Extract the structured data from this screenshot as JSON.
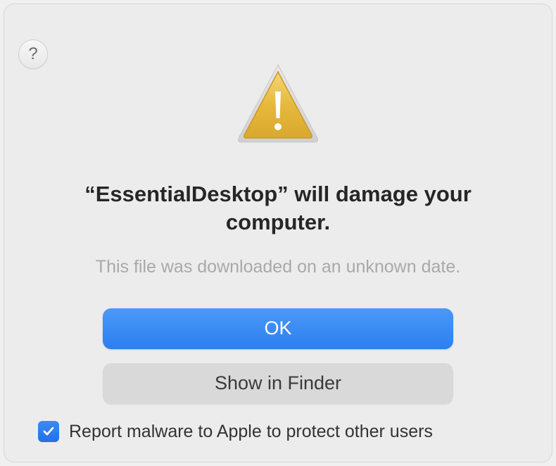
{
  "dialog": {
    "title": "“EssentialDesktop” will damage your computer.",
    "subtitle": "This file was downloaded on an unknown date.",
    "help_label": "?"
  },
  "buttons": {
    "ok": "OK",
    "show_in_finder": "Show in Finder"
  },
  "checkbox": {
    "label": "Report malware to Apple to protect other users",
    "checked": true
  },
  "colors": {
    "primary": "#2b7ff0",
    "secondary": "#d9d9d9",
    "background": "#ececec"
  }
}
